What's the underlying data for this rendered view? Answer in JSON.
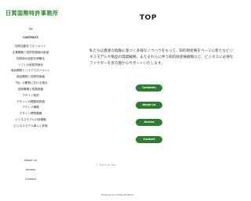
{
  "site": {
    "logo_text": "日賀国際特許事務所"
  },
  "sidebar": {
    "top_label": "Top",
    "contents_label": "CONTENTS",
    "items": [
      "知財活動をマネジメント",
      "企業戦略と知財的価値の創造",
      "知財部の役割を明確化",
      "ソフトの経営資産化",
      "商品開発とリスクマネジメント",
      "商品開発と知財知価値",
      "「知」の開発における視点",
      "技術戦略と知度価値",
      "デザイン知的",
      "デザインの開発経営価",
      "ブランド戦略",
      "デザイン標準戦略",
      "ビジネスモデルの評価戦",
      "ビジネスモデル導入と評価"
    ],
    "bottom": {
      "about": "About us",
      "access": "Access",
      "contact": "Contact"
    }
  },
  "main": {
    "title": "TOP",
    "intro": "私たちは豊富な経験に基づく多様なノウハウをもって、知的財産権をベースに新たなビジネスモデルや製品の開発戦略、またそれらに伴う知的財産権戦略など、ビジネスに必要なファクターを多方面からサポートいたします。",
    "buttons": {
      "contents": "Contents",
      "about": "About us",
      "access": "Access",
      "contact": "Contact"
    },
    "back_to_top": "Back to Top",
    "back_icon": "chevron-up-icon"
  },
  "footer": {
    "powered": "Powered by Adobe Portfolio"
  },
  "colors": {
    "accent": "#2e7d32",
    "logo": "#2c8a2c"
  }
}
